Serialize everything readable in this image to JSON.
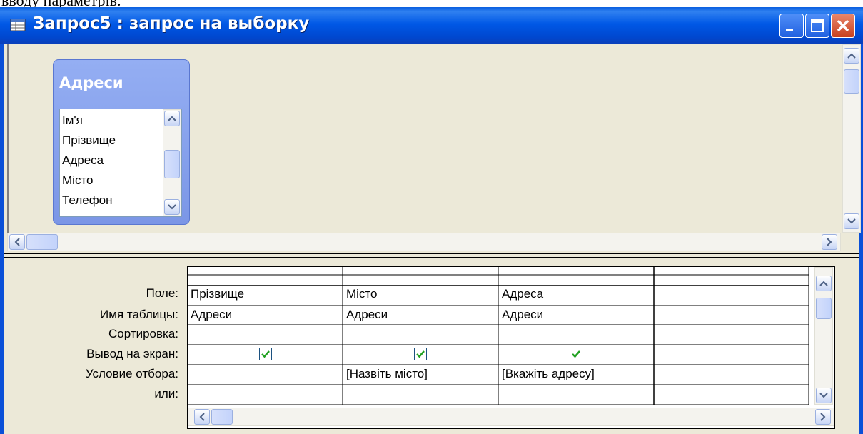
{
  "document_text": "вводу параметрів.",
  "window": {
    "title": "Запрос5 : запрос на выборку"
  },
  "table_box": {
    "title": "Адреси",
    "fields": [
      "Ім'я",
      "Прізвище",
      "Адреса",
      "Місто",
      "Телефон"
    ]
  },
  "grid": {
    "row_labels": [
      "Поле:",
      "Имя таблицы:",
      "Сортировка:",
      "Вывод на экран:",
      "Условие отбора:",
      "или:"
    ],
    "columns": [
      {
        "field": "Прізвище",
        "table": "Адреси",
        "sort": "",
        "show": true,
        "criteria": "",
        "or": ""
      },
      {
        "field": "Місто",
        "table": "Адреси",
        "sort": "",
        "show": true,
        "criteria": "[Назвіть місто]",
        "or": ""
      },
      {
        "field": "Адреса",
        "table": "Адреси",
        "sort": "",
        "show": true,
        "criteria": "[Вкажіть адресу]",
        "or": ""
      },
      {
        "field": "",
        "table": "",
        "sort": "",
        "show": false,
        "criteria": "",
        "or": ""
      }
    ]
  }
}
